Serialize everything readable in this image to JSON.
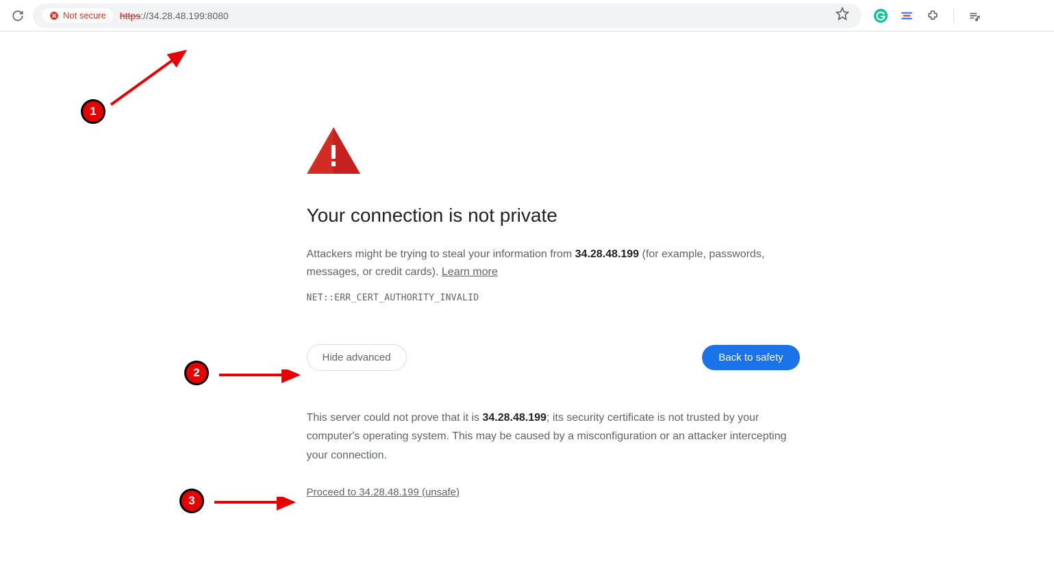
{
  "toolbar": {
    "security_label": "Not secure",
    "url_protocol": "https",
    "url_rest": "://34.28.48.199:8080"
  },
  "interstitial": {
    "heading": "Your connection is not private",
    "message_prefix": "Attackers might be trying to steal your information from ",
    "message_host": "34.28.48.199",
    "message_suffix": " (for example, passwords, messages, or credit cards). ",
    "learn_more": "Learn more",
    "error_code": "NET::ERR_CERT_AUTHORITY_INVALID",
    "hide_advanced": "Hide advanced",
    "back_to_safety": "Back to safety",
    "advanced_prefix": "This server could not prove that it is ",
    "advanced_host": "34.28.48.199",
    "advanced_suffix": "; its security certificate is not trusted by your computer's operating system. This may be caused by a misconfiguration or an attacker intercepting your connection.",
    "proceed_link": "Proceed to 34.28.48.199 (unsafe)"
  },
  "annotations": {
    "one": "1",
    "two": "2",
    "three": "3"
  }
}
